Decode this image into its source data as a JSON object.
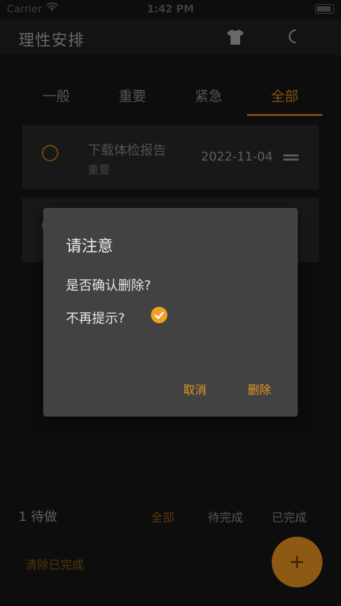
{
  "status_bar": {
    "carrier": "Carrier",
    "time": "1:42 PM"
  },
  "app_bar": {
    "title": "理性安排",
    "icons": [
      "shirt-icon",
      "moon-icon"
    ]
  },
  "tabs": [
    {
      "label": "一般",
      "active": false
    },
    {
      "label": "重要",
      "active": false
    },
    {
      "label": "紧急",
      "active": false
    },
    {
      "label": "全部",
      "active": true
    }
  ],
  "tasks": [
    {
      "title": "下载体检报告",
      "tag": "重要",
      "date": "2022-11-04"
    }
  ],
  "dialog": {
    "title": "请注意",
    "message": "是否确认删除?",
    "checkbox_label": "不再提示?",
    "checkbox_checked": true,
    "cancel": "取消",
    "confirm": "删除"
  },
  "footer": {
    "count": "1 待做",
    "filters": [
      {
        "label": "全部",
        "active": true
      },
      {
        "label": "待完成",
        "active": false
      },
      {
        "label": "已完成",
        "active": false
      }
    ],
    "clear_completed": "清除已完成"
  },
  "colors": {
    "accent": "#f0a022",
    "background": "#141414",
    "card": "#242424",
    "dialog": "#424242"
  }
}
